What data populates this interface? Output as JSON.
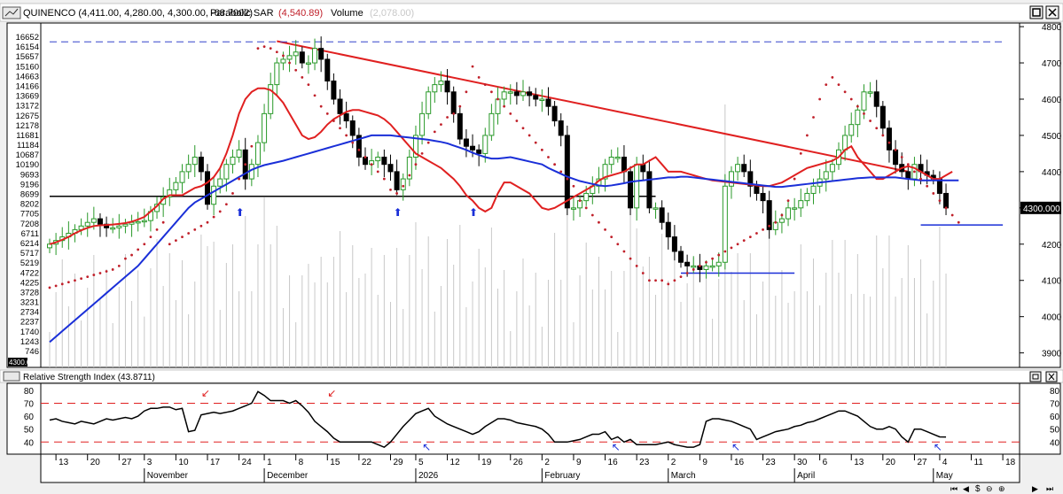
{
  "header": {
    "title": "QUINENCO (4,411.00, 4,280.00, 4,300.00, -68.7002)",
    "sar_label": "Parabolic SAR",
    "sar_value": "(4,540.89)",
    "volume_label": "Volume",
    "volume_value": "(2,078.00)"
  },
  "rsi_header": {
    "title": "Relative Strength Index (43.8711)"
  },
  "colors": {
    "sma_short": "#e02020",
    "sma_long": "#1a2fd8",
    "trendline": "#e02020",
    "sar": "#c0202a",
    "candle_up": "#2a9a2a",
    "volume": "#c8c8c8",
    "price_badge": "#000000"
  },
  "chart_data": [
    {
      "type": "candlestick",
      "title": "QUINENCO",
      "ylim": [
        3860,
        4810
      ],
      "right_axis_ticks": [
        4800,
        4700,
        4600,
        4500,
        4400,
        4300,
        4200,
        4100,
        4000,
        3900
      ],
      "volume_axis_ticks": [
        16652,
        16154,
        15657,
        15160,
        14663,
        14166,
        13669,
        13172,
        12675,
        12178,
        11681,
        11184,
        10687,
        10190,
        9693,
        9196,
        8699,
        8202,
        7705,
        7208,
        6711,
        6214,
        5717,
        5219,
        4722,
        4225,
        3728,
        3231,
        2734,
        2237,
        1740,
        1243,
        746
      ],
      "current_price": "4300.000",
      "volume_badge": "4300.00",
      "x_ticks": [
        {
          "i": 1,
          "label": "13"
        },
        {
          "i": 6,
          "label": "20"
        },
        {
          "i": 11,
          "label": "27"
        },
        {
          "i": 15,
          "label": "3"
        },
        {
          "i": 20,
          "label": "10"
        },
        {
          "i": 25,
          "label": "17"
        },
        {
          "i": 30,
          "label": "24"
        },
        {
          "i": 34,
          "label": "1"
        },
        {
          "i": 39,
          "label": "8"
        },
        {
          "i": 44,
          "label": "15"
        },
        {
          "i": 49,
          "label": "22"
        },
        {
          "i": 54,
          "label": "29"
        },
        {
          "i": 58,
          "label": "5"
        },
        {
          "i": 63,
          "label": "12"
        },
        {
          "i": 68,
          "label": "19"
        },
        {
          "i": 73,
          "label": "26"
        },
        {
          "i": 78,
          "label": "2"
        },
        {
          "i": 83,
          "label": "9"
        },
        {
          "i": 88,
          "label": "16"
        },
        {
          "i": 93,
          "label": "23"
        },
        {
          "i": 98,
          "label": "2"
        },
        {
          "i": 103,
          "label": "9"
        },
        {
          "i": 108,
          "label": "16"
        },
        {
          "i": 113,
          "label": "23"
        },
        {
          "i": 118,
          "label": "30"
        },
        {
          "i": 122,
          "label": "6"
        },
        {
          "i": 127,
          "label": "13"
        },
        {
          "i": 132,
          "label": "20"
        },
        {
          "i": 137,
          "label": "27"
        },
        {
          "i": 141,
          "label": "4"
        },
        {
          "i": 146,
          "label": "11"
        },
        {
          "i": 151,
          "label": "18"
        }
      ],
      "months": [
        {
          "i": 15,
          "label": "November"
        },
        {
          "i": 34,
          "label": "December"
        },
        {
          "i": 58,
          "label": "2026"
        },
        {
          "i": 78,
          "label": "February"
        },
        {
          "i": 98,
          "label": "March"
        },
        {
          "i": 118,
          "label": "April"
        },
        {
          "i": 140,
          "label": "May"
        }
      ],
      "closes": [
        4200,
        4210,
        4220,
        4230,
        4240,
        4250,
        4260,
        4270,
        4255,
        4245,
        4245,
        4250,
        4255,
        4260,
        4262,
        4265,
        4290,
        4310,
        4330,
        4350,
        4370,
        4400,
        4420,
        4440,
        4400,
        4310,
        4360,
        4380,
        4420,
        4440,
        4460,
        4380,
        4420,
        4480,
        4560,
        4640,
        4700,
        4710,
        4720,
        4730,
        4700,
        4700,
        4740,
        4710,
        4650,
        4600,
        4560,
        4540,
        4500,
        4440,
        4420,
        4430,
        4440,
        4420,
        4400,
        4350,
        4380,
        4440,
        4500,
        4560,
        4620,
        4640,
        4650,
        4620,
        4560,
        4490,
        4470,
        4460,
        4450,
        4500,
        4560,
        4600,
        4620,
        4620,
        4610,
        4620,
        4610,
        4600,
        4600,
        4580,
        4540,
        4500,
        4300,
        4300,
        4320,
        4340,
        4360,
        4380,
        4420,
        4440,
        4440,
        4400,
        4300,
        4420,
        4400,
        4300,
        4300,
        4260,
        4220,
        4180,
        4150,
        4140,
        4140,
        4130,
        4140,
        4140,
        4150,
        4360,
        4400,
        4420,
        4400,
        4360,
        4340,
        4320,
        4240,
        4260,
        4270,
        4300,
        4300,
        4320,
        4340,
        4360,
        4380,
        4400,
        4420,
        4460,
        4500,
        4530,
        4570,
        4620,
        4620,
        4580,
        4520,
        4460,
        4420,
        4400,
        4380,
        4420,
        4400,
        4390,
        4380,
        4340,
        4300
      ],
      "series": [
        {
          "name": "sma_short",
          "values": [
            4200,
            4205,
            4212,
            4220,
            4230,
            4238,
            4245,
            4250,
            4252,
            4253,
            4254,
            4256,
            4258,
            4262,
            4268,
            4275,
            4290,
            4305,
            4325,
            4335,
            4335,
            4335,
            4345,
            4355,
            4360,
            4370,
            4385,
            4410,
            4450,
            4500,
            4560,
            4600,
            4620,
            4630,
            4630,
            4625,
            4610,
            4590,
            4560,
            4530,
            4500,
            4490,
            4495,
            4510,
            4530,
            4545,
            4555,
            4565,
            4570,
            4570,
            4565,
            4560,
            4555,
            4545,
            4530,
            4510,
            4490,
            4470,
            4450,
            4440,
            4430,
            4420,
            4410,
            4395,
            4380,
            4360,
            4335,
            4320,
            4300,
            4290,
            4300,
            4340,
            4370,
            4370,
            4360,
            4350,
            4340,
            4320,
            4300,
            4295,
            4300,
            4310,
            4320,
            4330,
            4340,
            4350,
            4360,
            4375,
            4385,
            4390,
            4395,
            4400,
            4410,
            4420,
            4420,
            4430,
            4440,
            4420,
            4400,
            4400,
            4400,
            4395,
            4390,
            4385,
            4380,
            4376,
            4374,
            4372,
            4370,
            4368,
            4366,
            4364,
            4362,
            4360,
            4360,
            4365,
            4370,
            4380,
            4390,
            4400,
            4410,
            4415,
            4420,
            4425,
            4430,
            4440,
            4460,
            4470,
            4440,
            4420,
            4400,
            4380,
            4380,
            4390,
            4400,
            4410,
            4415,
            4410,
            4400,
            4390,
            4380,
            4380,
            4390,
            4400
          ]
        },
        {
          "name": "sma_long",
          "values": [
            3930,
            3945,
            3960,
            3975,
            3990,
            4005,
            4020,
            4035,
            4050,
            4065,
            4080,
            4095,
            4110,
            4125,
            4140,
            4160,
            4180,
            4200,
            4220,
            4240,
            4260,
            4280,
            4300,
            4315,
            4325,
            4335,
            4345,
            4355,
            4365,
            4375,
            4385,
            4395,
            4405,
            4412,
            4418,
            4422,
            4426,
            4430,
            4435,
            4440,
            4445,
            4450,
            4455,
            4460,
            4465,
            4470,
            4475,
            4480,
            4485,
            4490,
            4495,
            4500,
            4500,
            4500,
            4500,
            4498,
            4496,
            4494,
            4492,
            4490,
            4488,
            4485,
            4482,
            4478,
            4472,
            4466,
            4460,
            4452,
            4446,
            4440,
            4436,
            4436,
            4438,
            4440,
            4436,
            4432,
            4428,
            4424,
            4420,
            4410,
            4402,
            4394,
            4386,
            4380,
            4374,
            4370,
            4366,
            4362,
            4360,
            4362,
            4365,
            4368,
            4372,
            4374,
            4376,
            4378,
            4380,
            4382,
            4384,
            4384,
            4386,
            4386,
            4384,
            4382,
            4380,
            4378,
            4376,
            4374,
            4372,
            4370,
            4368,
            4366,
            4364,
            4362,
            4360,
            4358,
            4358,
            4360,
            4362,
            4364,
            4366,
            4368,
            4370,
            4372,
            4374,
            4376,
            4378,
            4380,
            4382,
            4383,
            4384,
            4384,
            4384,
            4384,
            4384,
            4382,
            4380,
            4378,
            4376,
            4376,
            4376,
            4376,
            4376,
            4376,
            4376
          ]
        },
        {
          "name": "sar",
          "values": [
            4080,
            4085,
            4090,
            4095,
            4100,
            4105,
            4110,
            4115,
            4120,
            4125,
            4130,
            4140,
            4160,
            4170,
            4185,
            4200,
            4220,
            4240,
            4260,
            4200,
            4210,
            4220,
            4230,
            4240,
            4250,
            4260,
            4275,
            4290,
            4310,
            4340,
            4380,
            4420,
            4470,
            4740,
            4745,
            4740,
            4730,
            4720,
            4700,
            4680,
            4660,
            4640,
            4610,
            4580,
            4560,
            4540,
            4520,
            4500,
            4480,
            4460,
            4440,
            4420,
            4400,
            4380,
            4350,
            4340,
            4360,
            4390,
            4420,
            4450,
            4480,
            4510,
            4530,
            4550,
            4560,
            4580,
            4620,
            4690,
            4660,
            4640,
            4620,
            4600,
            4580,
            4560,
            4540,
            4520,
            4500,
            4480,
            4460,
            4440,
            4420,
            4400,
            4380,
            4360,
            4320,
            4300,
            4280,
            4260,
            4240,
            4220,
            4200,
            4180,
            4160,
            4140,
            4120,
            4100,
            4100,
            4100,
            4090,
            4100,
            4110,
            4120,
            4130,
            4140,
            4150,
            4160,
            4170,
            4180,
            4190,
            4200,
            4210,
            4220,
            4230,
            4240,
            4250,
            4260,
            4280,
            4320,
            4380,
            4450,
            4500,
            4550,
            4600,
            4640,
            4660,
            4640,
            4620,
            4600,
            4580,
            4560,
            4540,
            4520,
            4500,
            4480,
            4460,
            4440,
            4420,
            4400,
            4380,
            4360,
            4340,
            4320,
            4300,
            4280,
            4260
          ]
        }
      ],
      "trendlines": [
        {
          "from": {
            "i": 36,
            "y": 4760
          },
          "to": {
            "i": 136,
            "y": 4400
          },
          "label": "resistance"
        },
        {
          "from": {
            "i": 0,
            "y": 4332
          },
          "to": {
            "i": 96,
            "y": 4332
          },
          "label": "support"
        },
        {
          "from": {
            "i": 0,
            "y": 4758
          },
          "to": {
            "i": 151,
            "y": 4758
          },
          "label": "top-dashed"
        },
        {
          "from": {
            "i": 100,
            "y": 4120
          },
          "to": {
            "i": 118,
            "y": 4120
          },
          "label": "march-low"
        },
        {
          "from": {
            "i": 138,
            "y": 4253
          },
          "to": {
            "i": 151,
            "y": 4253
          },
          "label": "may-low"
        }
      ],
      "arrows_up_at": [
        30,
        55,
        67
      ]
    },
    {
      "type": "line",
      "title": "Relative Strength Index",
      "ylim": [
        32,
        84
      ],
      "y_ticks": [
        80,
        70,
        60,
        50,
        40
      ],
      "bands": [
        70,
        40
      ],
      "values": [
        57,
        58,
        56,
        55,
        54,
        56,
        55,
        54,
        56,
        58,
        57,
        58,
        59,
        58,
        60,
        64,
        66,
        66,
        67,
        67,
        65,
        66,
        48,
        49,
        61,
        62,
        63,
        62,
        63,
        64,
        66,
        68,
        70,
        79,
        76,
        72,
        72,
        72,
        70,
        72,
        68,
        63,
        56,
        52,
        48,
        43,
        40,
        40,
        40,
        40,
        40,
        40,
        38,
        36,
        40,
        46,
        52,
        57,
        62,
        64,
        66,
        60,
        57,
        54,
        52,
        50,
        48,
        46,
        48,
        52,
        55,
        58,
        58,
        57,
        55,
        54,
        53,
        52,
        50,
        46,
        40,
        40,
        40,
        41,
        42,
        44,
        46,
        46,
        48,
        42,
        44,
        40,
        42,
        38,
        38,
        38,
        38,
        39,
        40,
        38,
        37,
        36,
        36,
        38,
        56,
        58,
        58,
        57,
        56,
        54,
        52,
        50,
        42,
        44,
        46,
        48,
        49,
        50,
        52,
        53,
        55,
        56,
        58,
        60,
        62,
        64,
        64,
        62,
        60,
        56,
        52,
        50,
        50,
        52,
        50,
        44,
        40,
        50,
        50,
        48,
        46,
        44,
        43.87
      ]
    }
  ]
}
